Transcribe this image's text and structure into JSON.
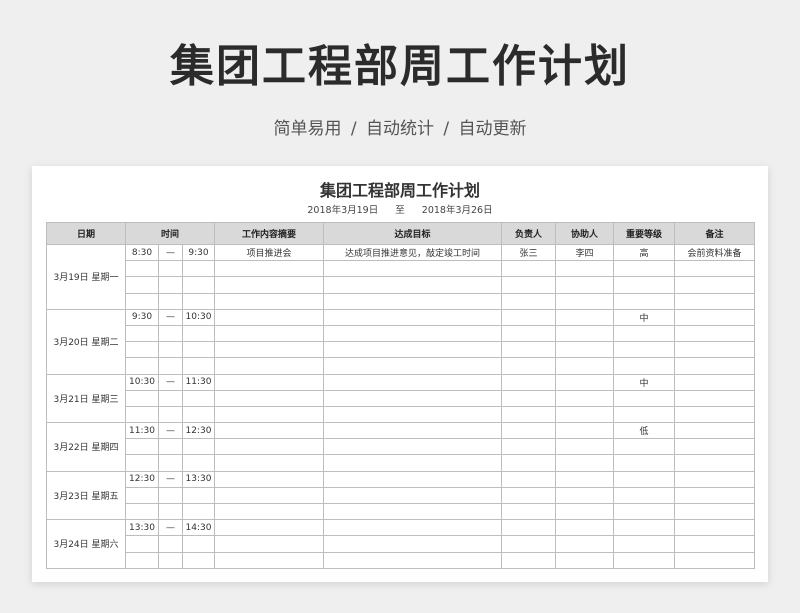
{
  "header": {
    "title": "集团工程部周工作计划",
    "subtitle": "简单易用 / 自动统计 / 自动更新"
  },
  "sheet": {
    "title": "集团工程部周工作计划",
    "start_date": "2018年3月19日",
    "to": "至",
    "end_date": "2018年3月26日"
  },
  "table": {
    "columns": [
      "日期",
      "时间",
      "工作内容摘要",
      "达成目标",
      "负责人",
      "协助人",
      "重要等级",
      "备注"
    ],
    "colors": {
      "red": "#d0262d",
      "blue": "#2a7fc0",
      "green": "#27a54a",
      "dark": "#333333"
    },
    "days": [
      {
        "date": "3月19日 星期一",
        "start": "8:30",
        "dash": "—",
        "end": "9:30",
        "summary": "项目推进会",
        "goal": "达成项目推进意见，敲定竣工时间",
        "owner": "张三",
        "assistant": "李四",
        "level": "高",
        "note": "会前资料准备",
        "color": "red"
      },
      {
        "date": "3月20日 星期二",
        "start": "9:30",
        "dash": "—",
        "end": "10:30",
        "summary": "",
        "goal": "",
        "owner": "",
        "assistant": "",
        "level": "中",
        "note": "",
        "color": "blue"
      },
      {
        "date": "3月21日 星期三",
        "start": "10:30",
        "dash": "—",
        "end": "11:30",
        "summary": "",
        "goal": "",
        "owner": "",
        "assistant": "",
        "level": "中",
        "note": "",
        "color": "blue"
      },
      {
        "date": "3月22日 星期四",
        "start": "11:30",
        "dash": "—",
        "end": "12:30",
        "summary": "",
        "goal": "",
        "owner": "",
        "assistant": "",
        "level": "低",
        "note": "",
        "color": "green"
      },
      {
        "date": "3月23日 星期五",
        "start": "12:30",
        "dash": "—",
        "end": "13:30",
        "summary": "",
        "goal": "",
        "owner": "",
        "assistant": "",
        "level": "",
        "note": "",
        "color": "dark"
      },
      {
        "date": "3月24日 星期六",
        "start": "13:30",
        "dash": "—",
        "end": "14:30",
        "summary": "",
        "goal": "",
        "owner": "",
        "assistant": "",
        "level": "",
        "note": "",
        "color": "dark"
      }
    ]
  }
}
